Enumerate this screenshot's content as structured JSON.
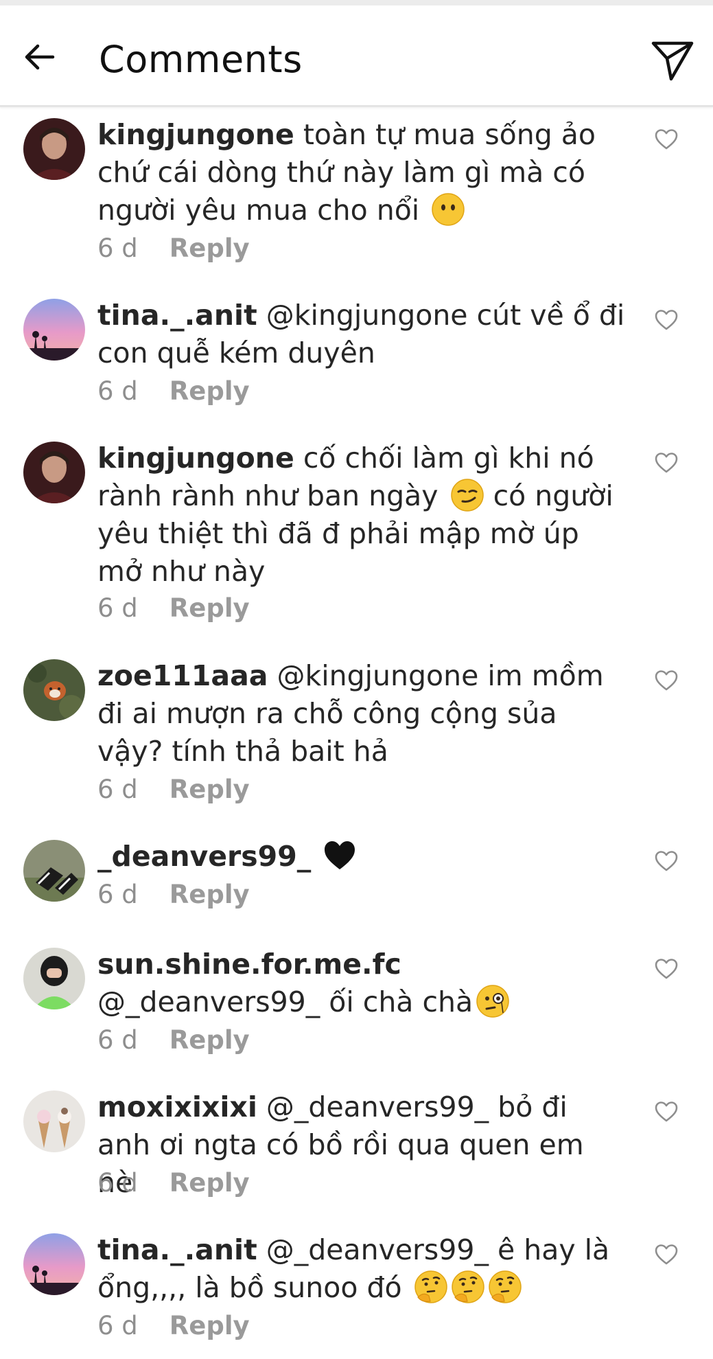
{
  "header": {
    "title": "Comments",
    "back_icon": "arrow-left-icon",
    "send_icon": "paper-plane-icon"
  },
  "comments": [
    {
      "username": "kingjungone",
      "text": " toàn tự mua sống ảo chứ cái dòng thứ này làm gì mà có người yêu mua cho nổi",
      "emoji": [
        "no-mouth-face-emoji"
      ],
      "time": "6 d",
      "reply": "Reply"
    },
    {
      "username": "tina._.anit",
      "text": " @kingjungone cút về ổ đi con quễ kém duyên",
      "emoji": [],
      "time": "6 d",
      "reply": "Reply"
    },
    {
      "username": "kingjungone",
      "text_parts": [
        " cố chối làm gì khi nó rành rành như ban ngày ",
        " có người yêu thiệt thì đã đ phải mập mờ úp mở như này"
      ],
      "emoji": [
        "smirk-face-emoji"
      ],
      "time": "6 d",
      "reply": "Reply"
    },
    {
      "username": "zoe111aaa",
      "text": " @kingjungone im mồm đi ai mượn ra chỗ công cộng sủa vậy? tính thả bait hả",
      "emoji": [],
      "time": "6 d",
      "reply": "Reply"
    },
    {
      "username": "_deanvers99_",
      "text": " ",
      "emoji": [
        "black-heart-emoji"
      ],
      "time": "6 d",
      "reply": "Reply"
    },
    {
      "username": "sun.shine.for.me.fc",
      "text": " @_deanvers99_ ối chà chà",
      "emoji": [
        "monocle-face-emoji"
      ],
      "time": "6 d",
      "reply": "Reply"
    },
    {
      "username": "moxixixixi",
      "text": " @_deanvers99_ bỏ đi anh ơi ngta có bồ rồi qua quen em nè",
      "emoji": [],
      "time": "6 d",
      "reply": "Reply"
    },
    {
      "username": "tina._.anit",
      "text": " @_deanvers99_ ê hay là ổng,,,, là bồ sunoo đó",
      "emoji": [
        "thinking-face-emoji",
        "thinking-face-emoji",
        "thinking-face-emoji"
      ],
      "time": "6 d",
      "reply": "Reply"
    }
  ],
  "icons": {
    "like": "heart-outline-icon"
  },
  "colors": {
    "text": "#262626",
    "meta": "#8e8e8e",
    "divider": "#e4e4e4",
    "heart": "#8e8e8e"
  }
}
